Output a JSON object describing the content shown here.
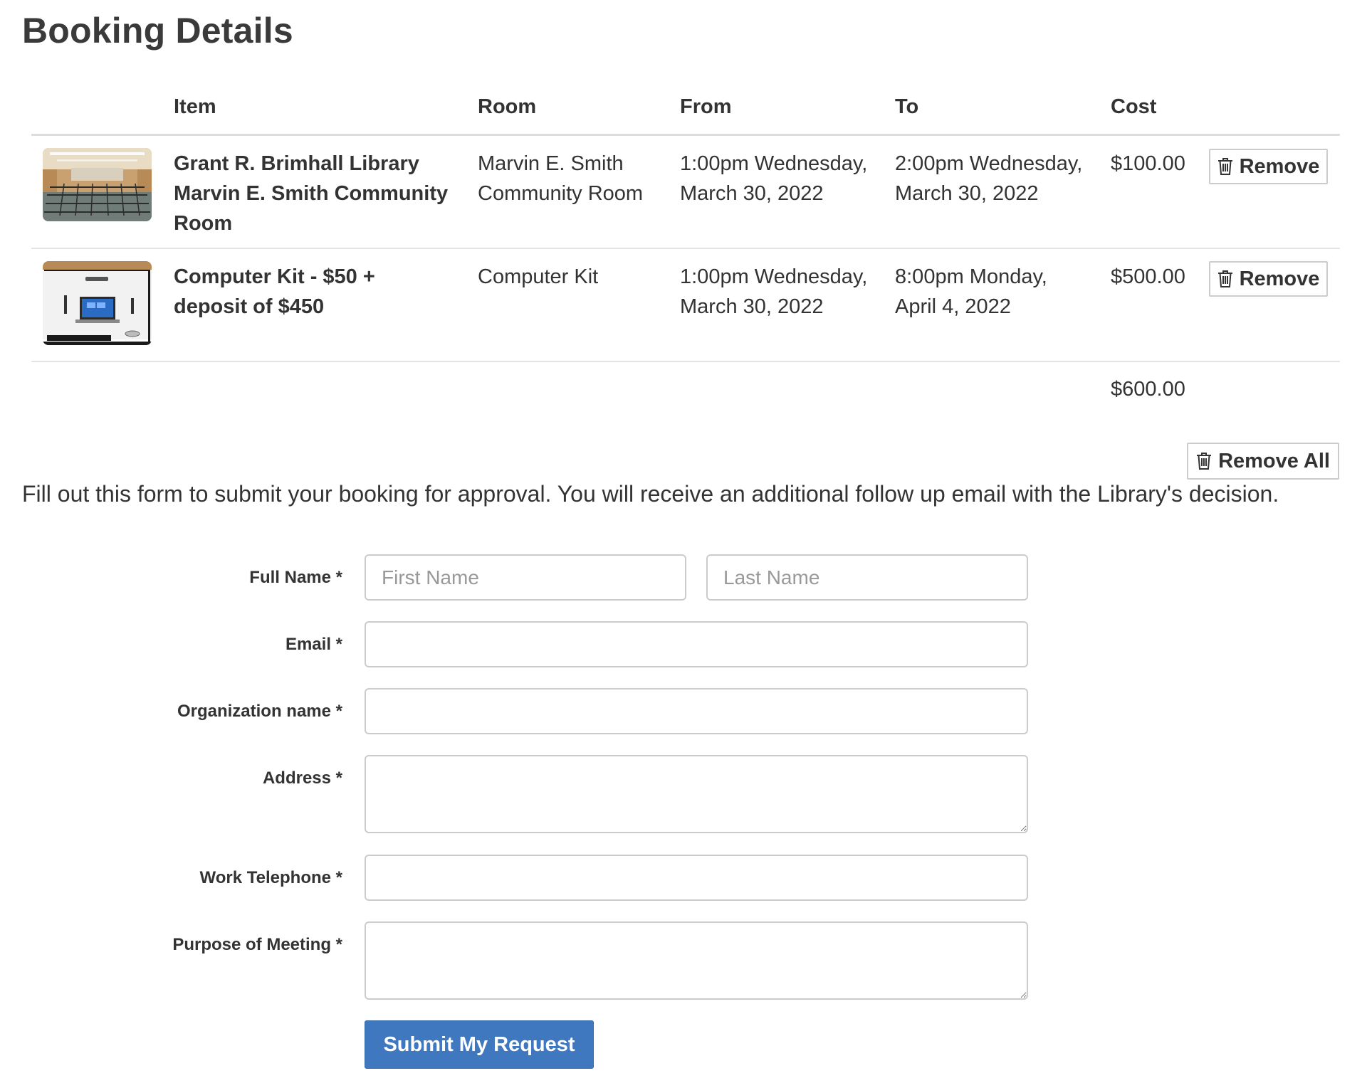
{
  "page": {
    "title": "Booking Details"
  },
  "table": {
    "headers": {
      "item": "Item",
      "room": "Room",
      "from": "From",
      "to": "To",
      "cost": "Cost"
    },
    "rows": [
      {
        "image": "meeting-room-photo",
        "item_line1": "Grant R. Brimhall Library",
        "item_line2": "Marvin E. Smith Community",
        "item_line3": "Room",
        "room_line1": "Marvin E. Smith",
        "room_line2": "Community Room",
        "from_line1": "1:00pm Wednesday,",
        "from_line2": "March 30, 2022",
        "to_line1": "2:00pm Wednesday,",
        "to_line2": "March 30, 2022",
        "cost": "$100.00",
        "remove_label": "Remove"
      },
      {
        "image": "computer-kit-photo",
        "item_line1": "Computer Kit - $50 +",
        "item_line2": "deposit of $450",
        "room_line1": "Computer Kit",
        "from_line1": "1:00pm Wednesday,",
        "from_line2": "March 30, 2022",
        "to_line1": "8:00pm Monday,",
        "to_line2": "April 4, 2022",
        "cost": "$500.00",
        "remove_label": "Remove"
      }
    ],
    "total": "$600.00",
    "remove_all_label": "Remove All"
  },
  "intro_text": "Fill out this form to submit your booking for approval. You will receive an additional follow up email with the Library's decision.",
  "form": {
    "full_name_label": "Full Name *",
    "first_name_placeholder": "First Name",
    "last_name_placeholder": "Last Name",
    "email_label": "Email *",
    "organization_label": "Organization name *",
    "address_label": "Address *",
    "work_telephone_label": "Work Telephone *",
    "purpose_label": "Purpose of Meeting *",
    "submit_label": "Submit My Request"
  },
  "colors": {
    "submit_button": "#3f78bf",
    "border": "#cccccc",
    "text": "#333333"
  },
  "icons": {
    "remove": "trash-icon"
  }
}
